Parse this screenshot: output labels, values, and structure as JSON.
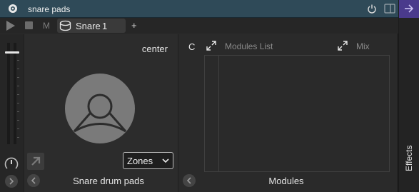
{
  "title_bar": {
    "title": "snare pads"
  },
  "toolbar": {
    "mute_label": "M",
    "chain_name": "Snare",
    "chain_index": "1",
    "add_label": "+"
  },
  "pads": {
    "pan_label": "center",
    "zones_value": "Zones",
    "footer": "Snare drum pads"
  },
  "modules": {
    "c_label": "C",
    "list_label": "Modules List",
    "mix_label": "Mix",
    "footer": "Modules"
  },
  "side": {
    "effects_label": "Effects"
  },
  "colors": {
    "title_bar": "#2f4a58",
    "side_accent": "#4a3a8c",
    "pad_fill": "#7a7a7a"
  }
}
